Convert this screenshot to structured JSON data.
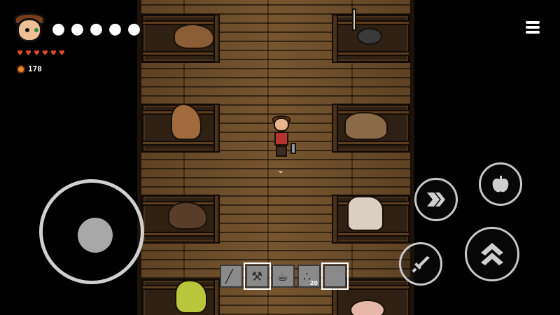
{
  "hud": {
    "player_portrait": "player-portrait",
    "hunger_apples": 5,
    "health_hearts": 6,
    "coins": "170",
    "menu_icon": "menu-icon"
  },
  "hotbar": {
    "slots": [
      {
        "name": "sword",
        "icon": "sword-icon",
        "count": ""
      },
      {
        "name": "hammer",
        "icon": "hammer-icon",
        "count": ""
      },
      {
        "name": "watering-can",
        "icon": "watering-can-icon",
        "count": ""
      },
      {
        "name": "seeds",
        "icon": "seeds-icon",
        "count": "20"
      },
      {
        "name": "empty",
        "icon": "",
        "count": ""
      }
    ]
  },
  "controls": {
    "joystick": "joystick",
    "dash": "dash-icon",
    "eat": "apple-icon",
    "attack": "sword-icon",
    "jump": "jump-icon"
  },
  "colors": {
    "floor": "#6a4c2a",
    "heart": "#e04a2f",
    "coin": "#e8862a"
  }
}
